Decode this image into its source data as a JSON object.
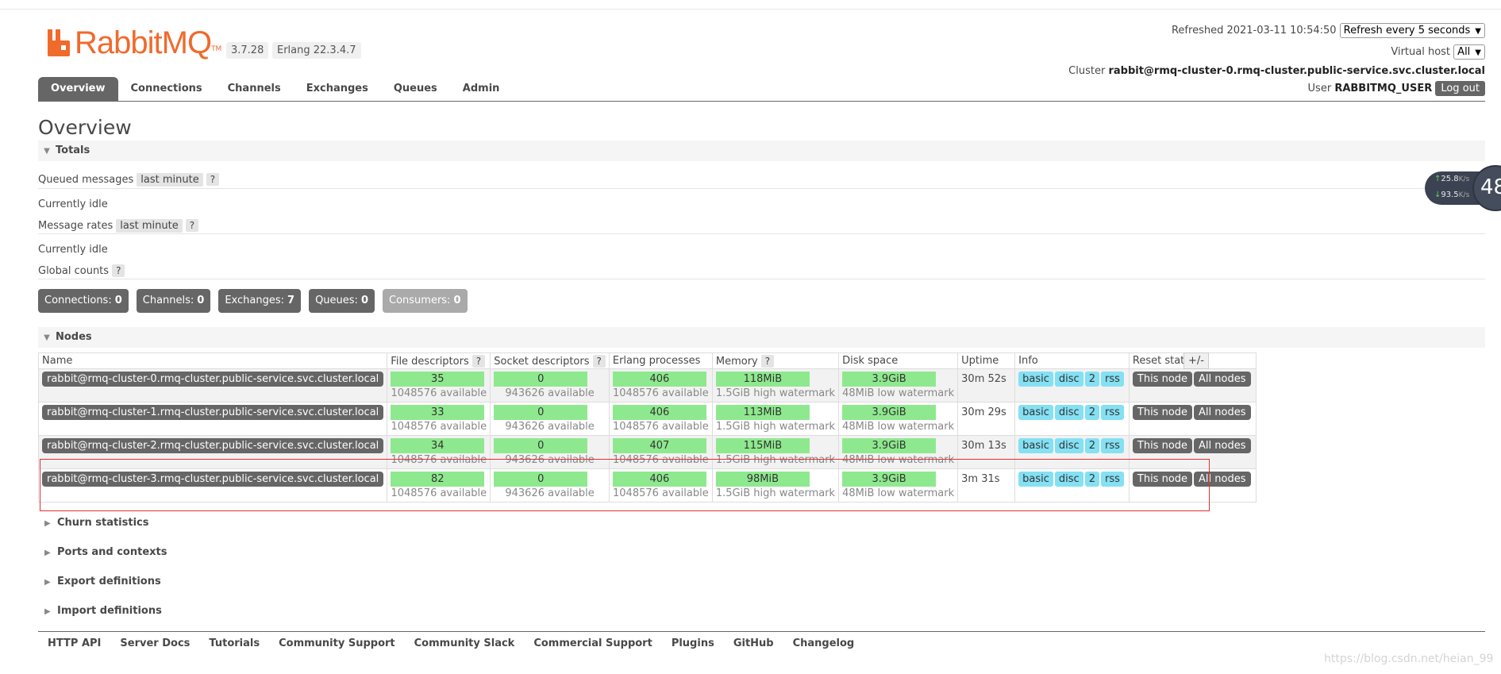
{
  "header": {
    "logo_text": "RabbitMQ",
    "logo_tm": "TM",
    "version": "3.7.28",
    "erlang": "Erlang 22.3.4.7",
    "refreshed_label": "Refreshed 2021-03-11 10:54:50",
    "refresh_select": "Refresh every 5 seconds",
    "vhost_label": "Virtual host",
    "vhost_select": "All",
    "cluster_label": "Cluster",
    "cluster_name": "rabbit@rmq-cluster-0.rmq-cluster.public-service.svc.cluster.local",
    "user_label": "User",
    "user_name": "RABBITMQ_USER",
    "logout": "Log out"
  },
  "tabs": [
    "Overview",
    "Connections",
    "Channels",
    "Exchanges",
    "Queues",
    "Admin"
  ],
  "page_title": "Overview",
  "totals": {
    "header": "Totals",
    "queued_messages": "Queued messages",
    "last_minute": "last minute",
    "help": "?",
    "currently_idle": "Currently idle",
    "message_rates": "Message rates",
    "global_counts": "Global counts",
    "counts": [
      {
        "label": "Connections:",
        "value": "0"
      },
      {
        "label": "Channels:",
        "value": "0"
      },
      {
        "label": "Exchanges:",
        "value": "7"
      },
      {
        "label": "Queues:",
        "value": "0"
      },
      {
        "label": "Consumers:",
        "value": "0"
      }
    ]
  },
  "nodes": {
    "header": "Nodes",
    "columns": [
      "Name",
      "File descriptors",
      "Socket descriptors",
      "Erlang processes",
      "Memory",
      "Disk space",
      "Uptime",
      "Info",
      "Reset stats"
    ],
    "plus_minus": "+/-",
    "info_tags": [
      "basic",
      "disc",
      "2",
      "rss"
    ],
    "this_node": "This node",
    "all_nodes": "All nodes",
    "rows": [
      {
        "name": "rabbit@rmq-cluster-0.rmq-cluster.public-service.svc.cluster.local",
        "fd": "35",
        "fd_avail": "1048576 available",
        "sd": "0",
        "sd_avail": "943626 available",
        "ep": "406",
        "ep_avail": "1048576 available",
        "mem": "118MiB",
        "mem_wm": "1.5GiB high watermark",
        "disk": "3.9GiB",
        "disk_wm": "48MiB low watermark",
        "uptime": "30m 52s"
      },
      {
        "name": "rabbit@rmq-cluster-1.rmq-cluster.public-service.svc.cluster.local",
        "fd": "33",
        "fd_avail": "1048576 available",
        "sd": "0",
        "sd_avail": "943626 available",
        "ep": "406",
        "ep_avail": "1048576 available",
        "mem": "113MiB",
        "mem_wm": "1.5GiB high watermark",
        "disk": "3.9GiB",
        "disk_wm": "48MiB low watermark",
        "uptime": "30m 29s"
      },
      {
        "name": "rabbit@rmq-cluster-2.rmq-cluster.public-service.svc.cluster.local",
        "fd": "34",
        "fd_avail": "1048576 available",
        "sd": "0",
        "sd_avail": "943626 available",
        "ep": "407",
        "ep_avail": "1048576 available",
        "mem": "115MiB",
        "mem_wm": "1.5GiB high watermark",
        "disk": "3.9GiB",
        "disk_wm": "48MiB low watermark",
        "uptime": "30m 13s"
      },
      {
        "name": "rabbit@rmq-cluster-3.rmq-cluster.public-service.svc.cluster.local",
        "fd": "82",
        "fd_avail": "1048576 available",
        "sd": "0",
        "sd_avail": "943626 available",
        "ep": "406",
        "ep_avail": "1048576 available",
        "mem": "98MiB",
        "mem_wm": "1.5GiB high watermark",
        "disk": "3.9GiB",
        "disk_wm": "48MiB low watermark",
        "uptime": "3m 31s"
      }
    ]
  },
  "collapsed_sections": [
    "Churn statistics",
    "Ports and contexts",
    "Export definitions",
    "Import definitions"
  ],
  "footer": [
    "HTTP API",
    "Server Docs",
    "Tutorials",
    "Community Support",
    "Community Slack",
    "Commercial Support",
    "Plugins",
    "GitHub",
    "Changelog"
  ],
  "watermark": "https://blog.csdn.net/heian_99",
  "net_widget": {
    "up": "25.8",
    "down": "93.5",
    "unit": "K/s",
    "value": "48"
  },
  "colors": {
    "accent": "#f06a2c",
    "bar_green": "#8ee98e",
    "info_blue": "#84e0f3",
    "dark_gray": "#666666",
    "highlight_red": "#e03030"
  }
}
